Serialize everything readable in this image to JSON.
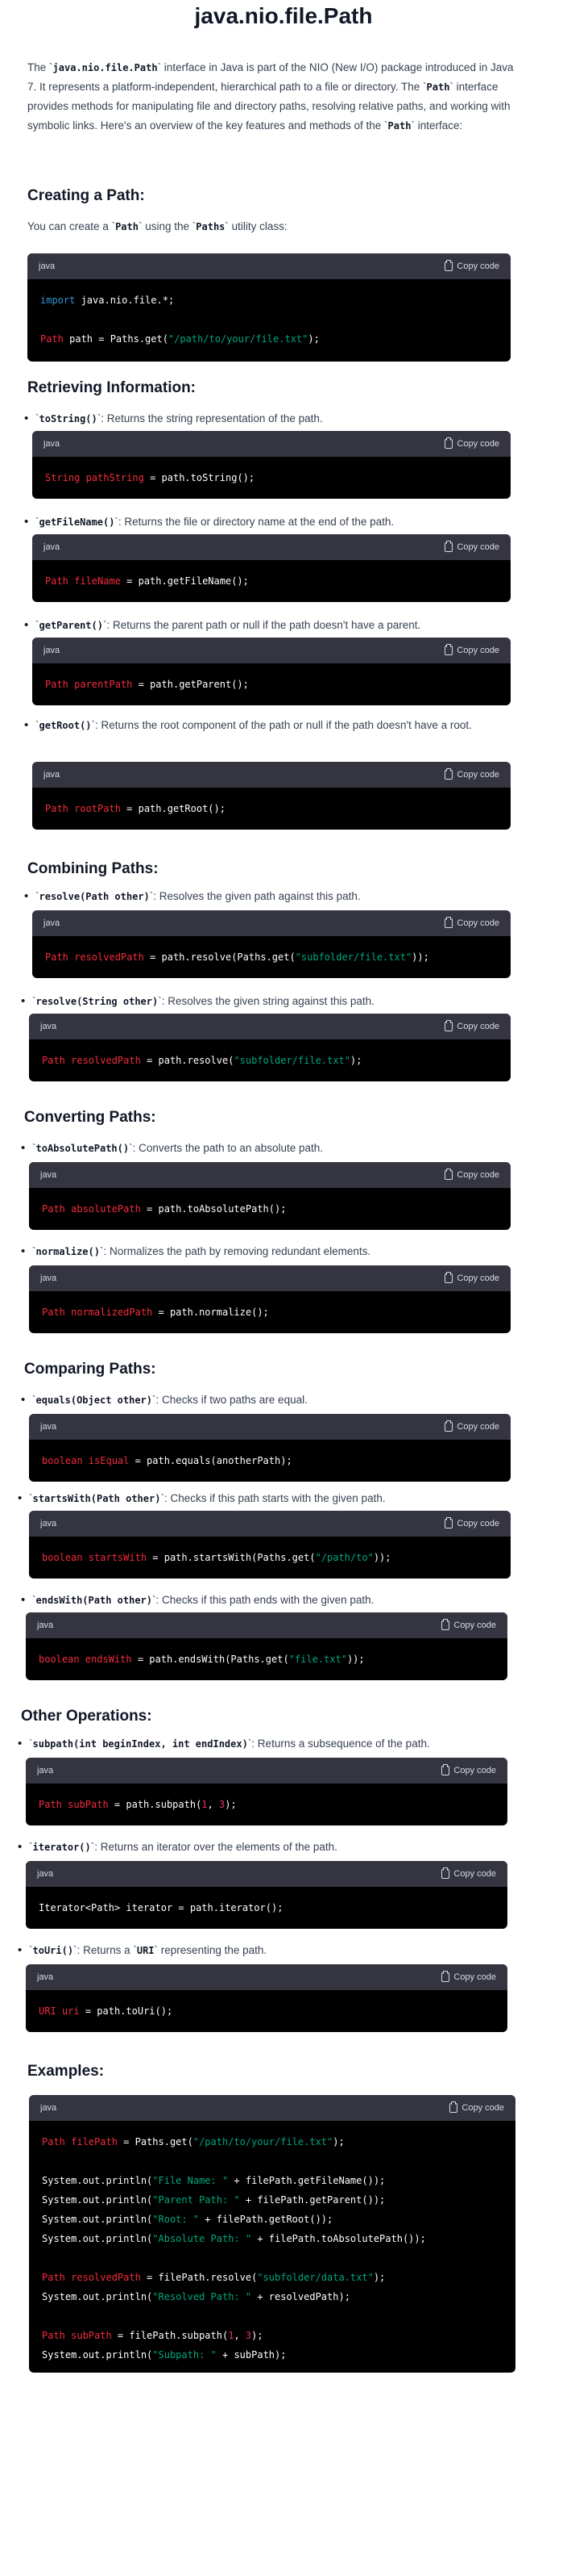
{
  "title": "java.nio.file.Path",
  "intro": {
    "pre": "The `",
    "code1": "java.nio.file.Path",
    "mid1": "` interface in Java is part of the NIO (New I/O) package introduced in Java 7. It represents a platform-independent, hierarchical path to a file or directory. The `",
    "code2": "Path",
    "mid2": "` interface provides methods for manipulating file and directory paths, resolving relative paths, and working with symbolic links. Here's an overview of the key features and methods of the `",
    "code3": "Path",
    "post": "` interface:"
  },
  "copy_label": "Copy code",
  "lang": "java",
  "sections": {
    "creating": {
      "heading": "Creating a Path:",
      "text_pre": "You can create a `",
      "code1": "Path",
      "text_mid": "` using the `",
      "code2": "Paths",
      "text_post": "` utility class:",
      "code": {
        "l1_kw": "import",
        "l1_rest": " java.nio.file.*;",
        "l2_ty": "Path",
        "l2_mid": " path = Paths.get(",
        "l2_str": "\"/path/to/your/file.txt\"",
        "l2_end": ");"
      }
    },
    "retrieving": {
      "heading": "Retrieving Information:",
      "items": [
        {
          "code": "toString()",
          "desc": "`: Returns the string representation of the path.",
          "ty": "String",
          "var": " pathString",
          "rest": " = path.toString();"
        },
        {
          "code": "getFileName()",
          "desc": "`: Returns the file or directory name at the end of the path.",
          "ty": "Path",
          "var": " fileName",
          "rest": " = path.getFileName();"
        },
        {
          "code": "getParent()",
          "desc": "`: Returns the parent path or null if the path doesn't have a parent.",
          "ty": "Path",
          "var": " parentPath",
          "rest": " = path.getParent();"
        },
        {
          "code": "getRoot()",
          "desc": "`: Returns the root component of the path or null if the path doesn't have a root.",
          "ty": "Path",
          "var": " rootPath",
          "rest": " = path.getRoot();"
        }
      ]
    },
    "combining": {
      "heading": "Combining Paths:",
      "items": [
        {
          "code": "resolve(Path other)",
          "desc": "`: Resolves the given path against this path.",
          "ty": "Path",
          "var": " resolvedPath",
          "rest": " = path.resolve(Paths.get(",
          "str": "\"subfolder/file.txt\"",
          "end": "));"
        },
        {
          "code": "resolve(String other)",
          "desc": "`: Resolves the given string against this path.",
          "ty": "Path",
          "var": " resolvedPath",
          "rest": " = path.resolve(",
          "str": "\"subfolder/file.txt\"",
          "end": ");"
        }
      ]
    },
    "converting": {
      "heading": "Converting Paths:",
      "items": [
        {
          "code": "toAbsolutePath()",
          "desc": "`: Converts the path to an absolute path.",
          "ty": "Path",
          "var": " absolutePath",
          "rest": " = path.toAbsolutePath();"
        },
        {
          "code": "normalize()",
          "desc": "`: Normalizes the path by removing redundant elements.",
          "ty": "Path",
          "var": " normalizedPath",
          "rest": " = path.normalize();"
        }
      ]
    },
    "comparing": {
      "heading": "Comparing Paths:",
      "items": [
        {
          "code": "equals(Object other)",
          "desc": "`: Checks if two paths are equal.",
          "ty": "boolean",
          "var": " isEqual",
          "rest": " = path.equals(anotherPath);"
        },
        {
          "code": "startsWith(Path other)",
          "desc": "`: Checks if this path starts with the given path.",
          "ty": "boolean",
          "var": " startsWith",
          "rest": " = path.startsWith(Paths.get(",
          "str": "\"/path/to\"",
          "end": "));"
        },
        {
          "code": "endsWith(Path other)",
          "desc": "`: Checks if this path ends with the given path.",
          "ty": "boolean",
          "var": " endsWith",
          "rest": " = path.endsWith(Paths.get(",
          "str": "\"file.txt\"",
          "end": "));"
        }
      ]
    },
    "other": {
      "heading": "Other Operations:",
      "items": [
        {
          "code": "subpath(int beginIndex, int endIndex)",
          "desc": "`: Returns a subsequence of the path.",
          "ty": "Path",
          "var": " subPath",
          "rest": " = path.subpath(",
          "n1": "1",
          "sep": ", ",
          "n2": "3",
          "end": ");"
        },
        {
          "code": "iterator()",
          "desc": "`: Returns an iterator over the elements of the path.",
          "line": "Iterator<Path> iterator = path.iterator();"
        },
        {
          "code": "toUri()",
          "desc_pre": "`: Returns a `",
          "code2": "URI",
          "desc_post": "` representing the path.",
          "ty": "URI",
          "var": " uri",
          "rest": " = path.toUri();"
        }
      ]
    },
    "examples": {
      "heading": "Examples:",
      "l1_ty": "Path",
      "l1_var": " filePath",
      "l1_rest": " = Paths.get(",
      "l1_str": "\"/path/to/your/file.txt\"",
      "l1_end": ");",
      "p1a": "System.out.println(",
      "p1s": "\"File Name: \"",
      "p1e": " + filePath.getFileName());",
      "p2a": "System.out.println(",
      "p2s": "\"Parent Path: \"",
      "p2e": " + filePath.getParent());",
      "p3a": "System.out.println(",
      "p3s": "\"Root: \"",
      "p3e": " + filePath.getRoot());",
      "p4a": "System.out.println(",
      "p4s": "\"Absolute Path: \"",
      "p4e": " + filePath.toAbsolutePath());",
      "r1_ty": "Path",
      "r1_var": " resolvedPath",
      "r1_rest": " = filePath.resolve(",
      "r1_str": "\"subfolder/data.txt\"",
      "r1_end": ");",
      "r2a": "System.out.println(",
      "r2s": "\"Resolved Path: \"",
      "r2e": " + resolvedPath);",
      "s1_ty": "Path",
      "s1_var": " subPath",
      "s1_rest": " = filePath.subpath(",
      "s1_n1": "1",
      "s1_sep": ", ",
      "s1_n2": "3",
      "s1_end": ");",
      "s2a": "System.out.println(",
      "s2s": "\"Subpath: \"",
      "s2e": " + subPath);"
    }
  }
}
